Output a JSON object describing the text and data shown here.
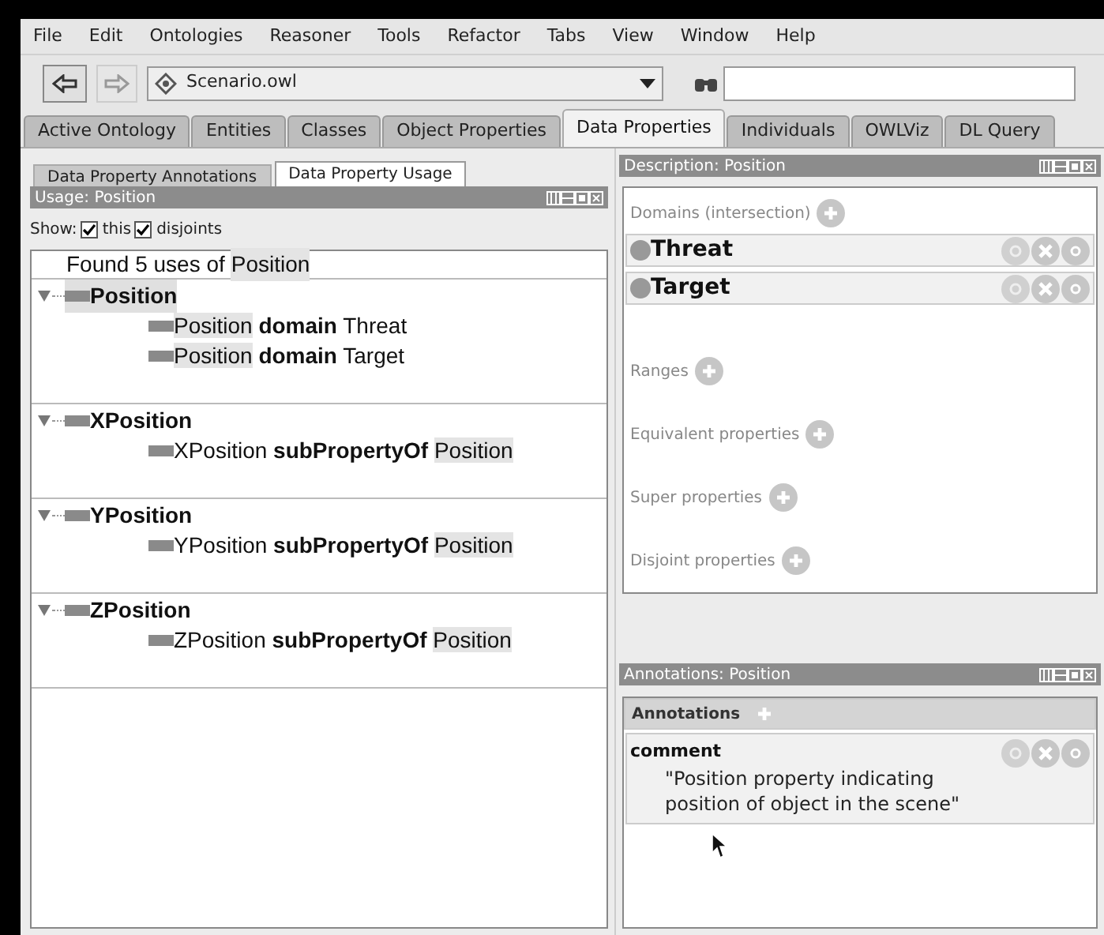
{
  "menu": [
    "File",
    "Edit",
    "Ontologies",
    "Reasoner",
    "Tools",
    "Refactor",
    "Tabs",
    "View",
    "Window",
    "Help"
  ],
  "toolbar": {
    "ontology": "Scenario.owl"
  },
  "tabs": [
    {
      "label": "Active Ontology",
      "selected": false
    },
    {
      "label": "Entities",
      "selected": false
    },
    {
      "label": "Classes",
      "selected": false
    },
    {
      "label": "Object Properties",
      "selected": false
    },
    {
      "label": "Data Properties",
      "selected": true
    },
    {
      "label": "Individuals",
      "selected": false
    },
    {
      "label": "OWLViz",
      "selected": false
    },
    {
      "label": "DL Query",
      "selected": false
    }
  ],
  "left": {
    "subtabs": [
      {
        "label": "Data Property Annotations",
        "selected": false
      },
      {
        "label": "Data Property Usage",
        "selected": true
      }
    ],
    "title": "Usage: Position",
    "show_label": "Show:",
    "show": [
      {
        "label": "this",
        "checked": true
      },
      {
        "label": "disjoints",
        "checked": true
      }
    ],
    "found": [
      {
        "text": "Found 5 uses of",
        "highlighted": false
      },
      {
        "text": "Position",
        "highlighted": true
      }
    ],
    "groups": [
      {
        "name": "Position",
        "highlighted": true,
        "expanded": true,
        "children": [
          [
            {
              "text": "Position",
              "kind": "entity",
              "highlighted": true
            },
            {
              "text": "domain",
              "kind": "keyword",
              "highlighted": false
            },
            {
              "text": "Threat",
              "kind": "entity",
              "highlighted": false
            }
          ],
          [
            {
              "text": "Position",
              "kind": "entity",
              "highlighted": true
            },
            {
              "text": "domain",
              "kind": "keyword",
              "highlighted": false
            },
            {
              "text": "Target",
              "kind": "entity",
              "highlighted": false
            }
          ]
        ]
      },
      {
        "name": "XPosition",
        "highlighted": false,
        "expanded": true,
        "children": [
          [
            {
              "text": "XPosition",
              "kind": "entity",
              "highlighted": false
            },
            {
              "text": "subPropertyOf",
              "kind": "keyword",
              "highlighted": false
            },
            {
              "text": "Position",
              "kind": "entity",
              "highlighted": true
            }
          ]
        ]
      },
      {
        "name": "YPosition",
        "highlighted": false,
        "expanded": true,
        "children": [
          [
            {
              "text": "YPosition",
              "kind": "entity",
              "highlighted": false
            },
            {
              "text": "subPropertyOf",
              "kind": "keyword",
              "highlighted": false
            },
            {
              "text": "Position",
              "kind": "entity",
              "highlighted": true
            }
          ]
        ]
      },
      {
        "name": "ZPosition",
        "highlighted": false,
        "expanded": true,
        "children": [
          [
            {
              "text": "ZPosition",
              "kind": "entity",
              "highlighted": false
            },
            {
              "text": "subPropertyOf",
              "kind": "keyword",
              "highlighted": false
            },
            {
              "text": "Position",
              "kind": "entity",
              "highlighted": true
            }
          ]
        ]
      }
    ]
  },
  "description": {
    "title": "Description: Position",
    "sections": [
      {
        "label": "Domains (intersection)",
        "items": [
          "Threat",
          "Target"
        ]
      },
      {
        "label": "Ranges"
      },
      {
        "label": "Equivalent properties"
      },
      {
        "label": "Super properties"
      },
      {
        "label": "Disjoint properties"
      }
    ]
  },
  "annotations": {
    "title": "Annotations: Position",
    "header": "Annotations",
    "entries": [
      {
        "property": "comment",
        "value": "\"Position property indicating position of object in the scene\""
      }
    ]
  }
}
